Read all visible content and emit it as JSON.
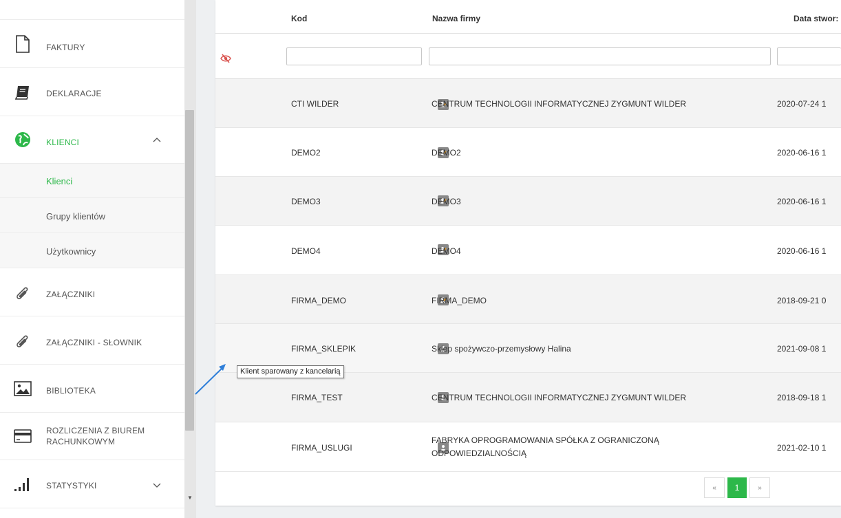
{
  "sidebar": {
    "items": [
      {
        "label": "FAKTURY",
        "icon": "document-icon"
      },
      {
        "label": "DEKLARACJE",
        "icon": "book-icon"
      },
      {
        "label": "KLIENCI",
        "icon": "globe-icon"
      },
      {
        "label": "ZAŁĄCZNIKI",
        "icon": "paperclip-icon"
      },
      {
        "label": "ZAŁĄCZNIKI - SŁOWNIK",
        "icon": "paperclip-icon"
      },
      {
        "label": "BIBLIOTEKA",
        "icon": "image-icon"
      },
      {
        "label": "ROZLICZENIA Z BIUREM RACHUNKOWYM",
        "icon": "card-icon"
      },
      {
        "label": "STATYSTYKI",
        "icon": "signal-bars-icon"
      }
    ],
    "subitems": [
      {
        "label": "Klienci"
      },
      {
        "label": "Grupy klientów"
      },
      {
        "label": "Użytkownicy"
      }
    ],
    "chevron_up": "^",
    "chevron_down": "﹀"
  },
  "table": {
    "headers": {
      "code": "Kod",
      "name": "Nazwa firmy",
      "date": "Data stwor:"
    },
    "rows": [
      {
        "code": "CTI WILDER",
        "name": "CENTRUM TECHNOLOGII INFORMATYCZNEJ ZYGMUNT WILDER",
        "date": "2020-07-24 1",
        "badge": "user-edit-icon"
      },
      {
        "code": "DEMO2",
        "name": "DEMO2",
        "date": "2020-06-16 1",
        "badge": "user-edit-icon"
      },
      {
        "code": "DEMO3",
        "name": "DEMO3",
        "date": "2020-06-16 1",
        "badge": "user-edit-icon"
      },
      {
        "code": "DEMO4",
        "name": "DEMO4",
        "date": "2020-06-16 1",
        "badge": "user-edit-icon"
      },
      {
        "code": "FIRMA_DEMO",
        "name": "FIRMA_DEMO",
        "date": "2018-09-21 0",
        "badge": "user-edit-icon"
      },
      {
        "code": "FIRMA_SKLEPIK",
        "name": "Sklep spożywczo-przemysłowy Halina",
        "date": "2021-09-08 1",
        "badge": "user-icon"
      },
      {
        "code": "FIRMA_TEST",
        "name": "CENTRUM TECHNOLOGII INFORMATYCZNEJ ZYGMUNT WILDER",
        "date": "2018-09-18 1",
        "badge": "user-icon"
      },
      {
        "code": "FIRMA_USLUGI",
        "name_line1": "FABRYKA OPROGRAMOWANIA SPÓŁKA Z OGRANICZONĄ",
        "name_line2": "ODPOWIEDZIALNOŚCIĄ",
        "date": "2021-02-10 1",
        "badge": "user-icon"
      }
    ]
  },
  "tooltip": "Klient sparowany z kancelarią",
  "pagination": {
    "prev": "«",
    "current": "1",
    "next": "»"
  },
  "colors": {
    "accent": "#2db84a",
    "badge": "#888888",
    "eye": "#d9534f",
    "arrow": "#2f7fd9"
  }
}
